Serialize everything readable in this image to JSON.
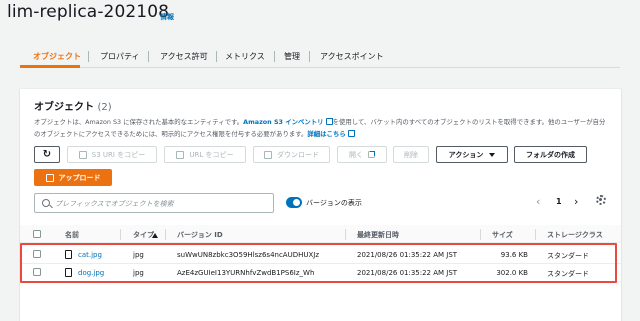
{
  "header": {
    "title": "lim-replica-202108",
    "info": "情報"
  },
  "tabs": [
    "オブジェクト",
    "プロパティ",
    "アクセス許可",
    "メトリクス",
    "管理",
    "アクセスポイント"
  ],
  "panel": {
    "title": "オブジェクト",
    "count": "(2)",
    "description_1": "オブジェクトは、Amazon S3 に保存された基本的なエンティティです。",
    "inventory_link": "Amazon S3 インベントリ",
    "description_2": "を使用して、バケット内のすべてのオブジェクトのリストを取得できます。他のユーザーが自分のオブジェクトにアクセスできるためには、明示的にアクセス権限を付与する必要があります。",
    "details_link": "詳細はこちら"
  },
  "toolbar": {
    "copy_s3_uri": "S3 URI をコピー",
    "copy_url": "URL をコピー",
    "download": "ダウンロード",
    "open": "開く",
    "delete": "削除",
    "actions": "アクション",
    "create_folder": "フォルダの作成",
    "upload": "アップロード"
  },
  "search": {
    "placeholder": "プレフィックスでオブジェクトを検索"
  },
  "versions_toggle": {
    "label": "バージョンの表示",
    "on": true
  },
  "pagination": {
    "page": "1",
    "prev": "‹",
    "next": "›"
  },
  "table": {
    "columns": [
      "名前",
      "タイプ",
      "バージョン ID",
      "最終更新日時",
      "サイズ",
      "ストレージクラス"
    ],
    "rows": [
      {
        "name": "cat.jpg",
        "type": "jpg",
        "version_id": "suWwUN8zbkc3O59Hlsz6s4ncAUDHUXJz",
        "modified": "2021/08/26 01:35:22 AM JST",
        "size": "93.6 KB",
        "storage_class": "スタンダード"
      },
      {
        "name": "dog.jpg",
        "type": "jpg",
        "version_id": "AzE4zGUIeI13YURNhfvZwdB1PS6Iz_Wh",
        "modified": "2021/08/26 01:35:22 AM JST",
        "size": "302.0 KB",
        "storage_class": "スタンダード"
      }
    ]
  },
  "colors": {
    "accent": "#ec7211",
    "link": "#0073bb",
    "highlight": "#e94a3f"
  }
}
